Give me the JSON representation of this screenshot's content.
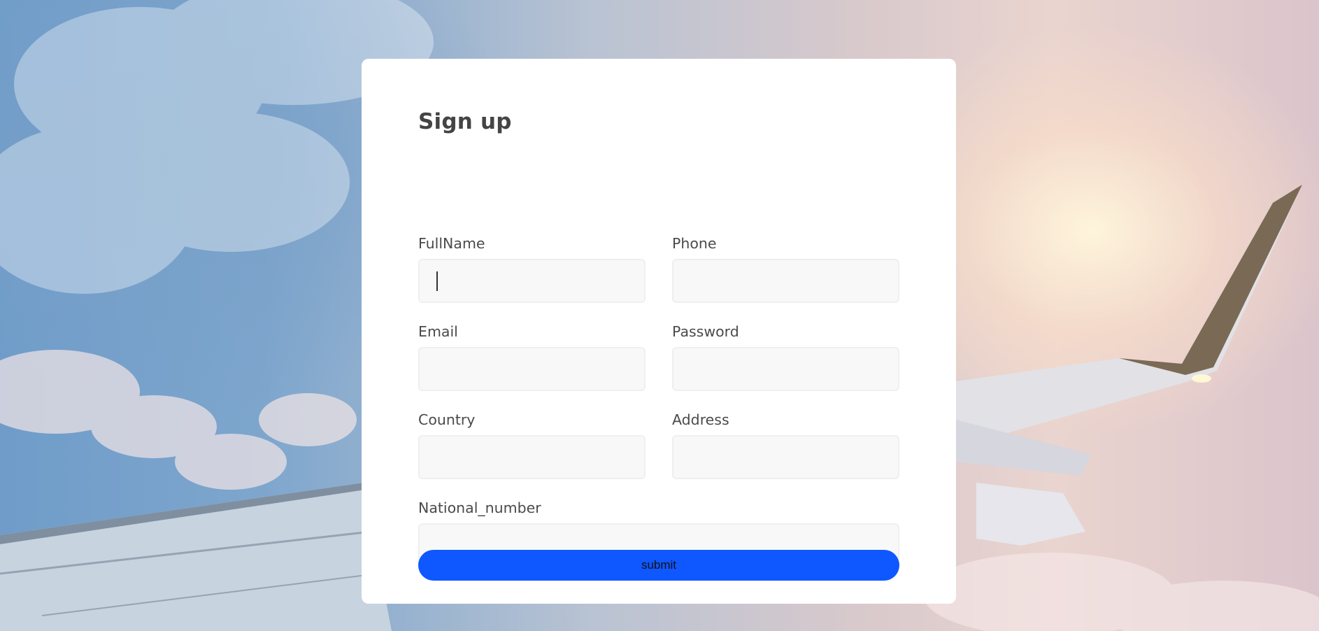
{
  "form": {
    "title": "Sign up",
    "fields": {
      "fullname": {
        "label": "FullName",
        "value": ""
      },
      "phone": {
        "label": "Phone",
        "value": ""
      },
      "email": {
        "label": "Email",
        "value": ""
      },
      "password": {
        "label": "Password",
        "value": ""
      },
      "country": {
        "label": "Country",
        "value": ""
      },
      "address": {
        "label": "Address",
        "value": ""
      },
      "national_number": {
        "label": "National_number",
        "value": ""
      }
    },
    "submit_label": "submit"
  },
  "colors": {
    "accent": "#0f57ff",
    "card": "#ffffff",
    "input_bg": "#f8f8f8",
    "text": "#4a4a4a"
  }
}
